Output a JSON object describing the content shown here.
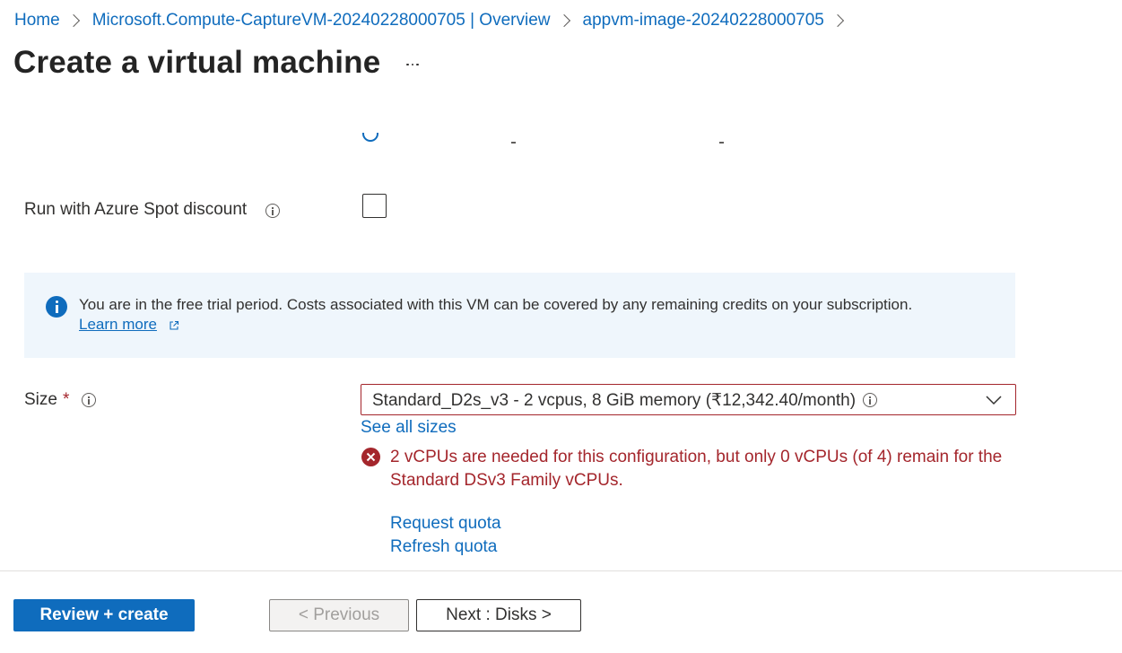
{
  "breadcrumb": {
    "items": [
      {
        "label": "Home"
      },
      {
        "label": "Microsoft.Compute-CaptureVM-20240228000705 | Overview"
      },
      {
        "label": "appvm-image-20240228000705"
      }
    ]
  },
  "header": {
    "title": "Create a virtual machine",
    "more_icon": "ellipsis-icon"
  },
  "spot": {
    "label": "Run with Azure Spot discount",
    "checked": false
  },
  "banner": {
    "text": "You are in the free trial period. Costs associated with this VM can be covered by any remaining credits on your subscription.",
    "link": "Learn more",
    "icon": "info-filled-icon"
  },
  "size": {
    "label": "Size",
    "required_mark": "*",
    "selected_value": "Standard_D2s_v3 - 2 vcpus, 8 GiB memory (₹12,342.40/month)",
    "see_all_link": "See all sizes",
    "error_text": "2 vCPUs are needed for this configuration, but only 0 vCPUs (of 4) remain for the Standard DSv3 Family vCPUs.",
    "request_quota_link": "Request quota",
    "refresh_quota_link": "Refresh quota"
  },
  "footer": {
    "review_create": "Review + create",
    "previous": "< Previous",
    "next": "Next : Disks >"
  },
  "colors": {
    "accent": "#0f6cbd",
    "error": "#a4262c",
    "banner_bg": "#eff6fc"
  }
}
